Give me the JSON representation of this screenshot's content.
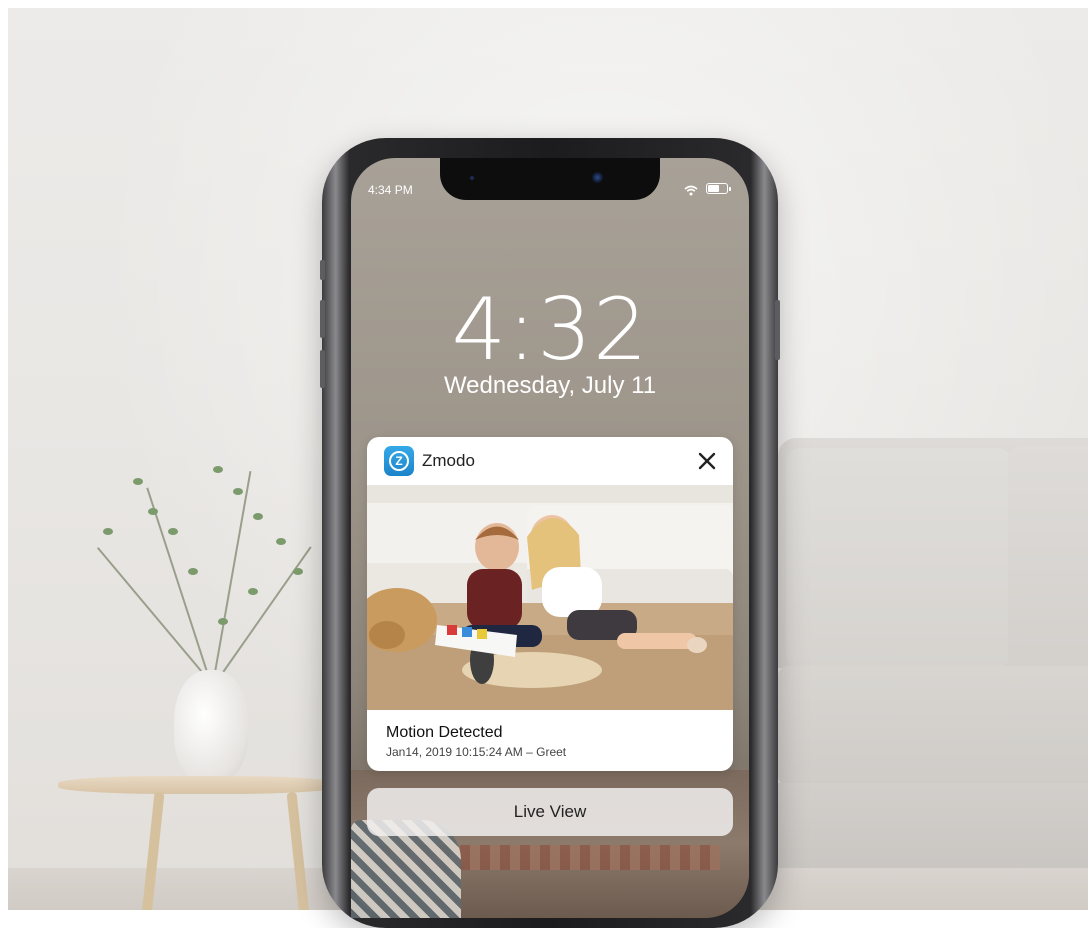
{
  "status_bar": {
    "time": "4:34 PM",
    "wifi_icon": "wifi-icon",
    "battery_icon": "battery-icon"
  },
  "lock_screen": {
    "time": "4:32",
    "date": "Wednesday, July 11"
  },
  "notification": {
    "app_icon": "zmodo-app-icon",
    "app_icon_letter": "Z",
    "app_name": "Zmodo",
    "close_icon": "close-icon",
    "title": "Motion Detected",
    "subtitle": "Jan14, 2019 10:15:24 AM – Greet"
  },
  "actions": {
    "live_view_label": "Live View"
  },
  "colors": {
    "app_icon_blue": "#2a98da",
    "notification_bg": "#ffffff",
    "button_bg": "#f0eeec"
  }
}
